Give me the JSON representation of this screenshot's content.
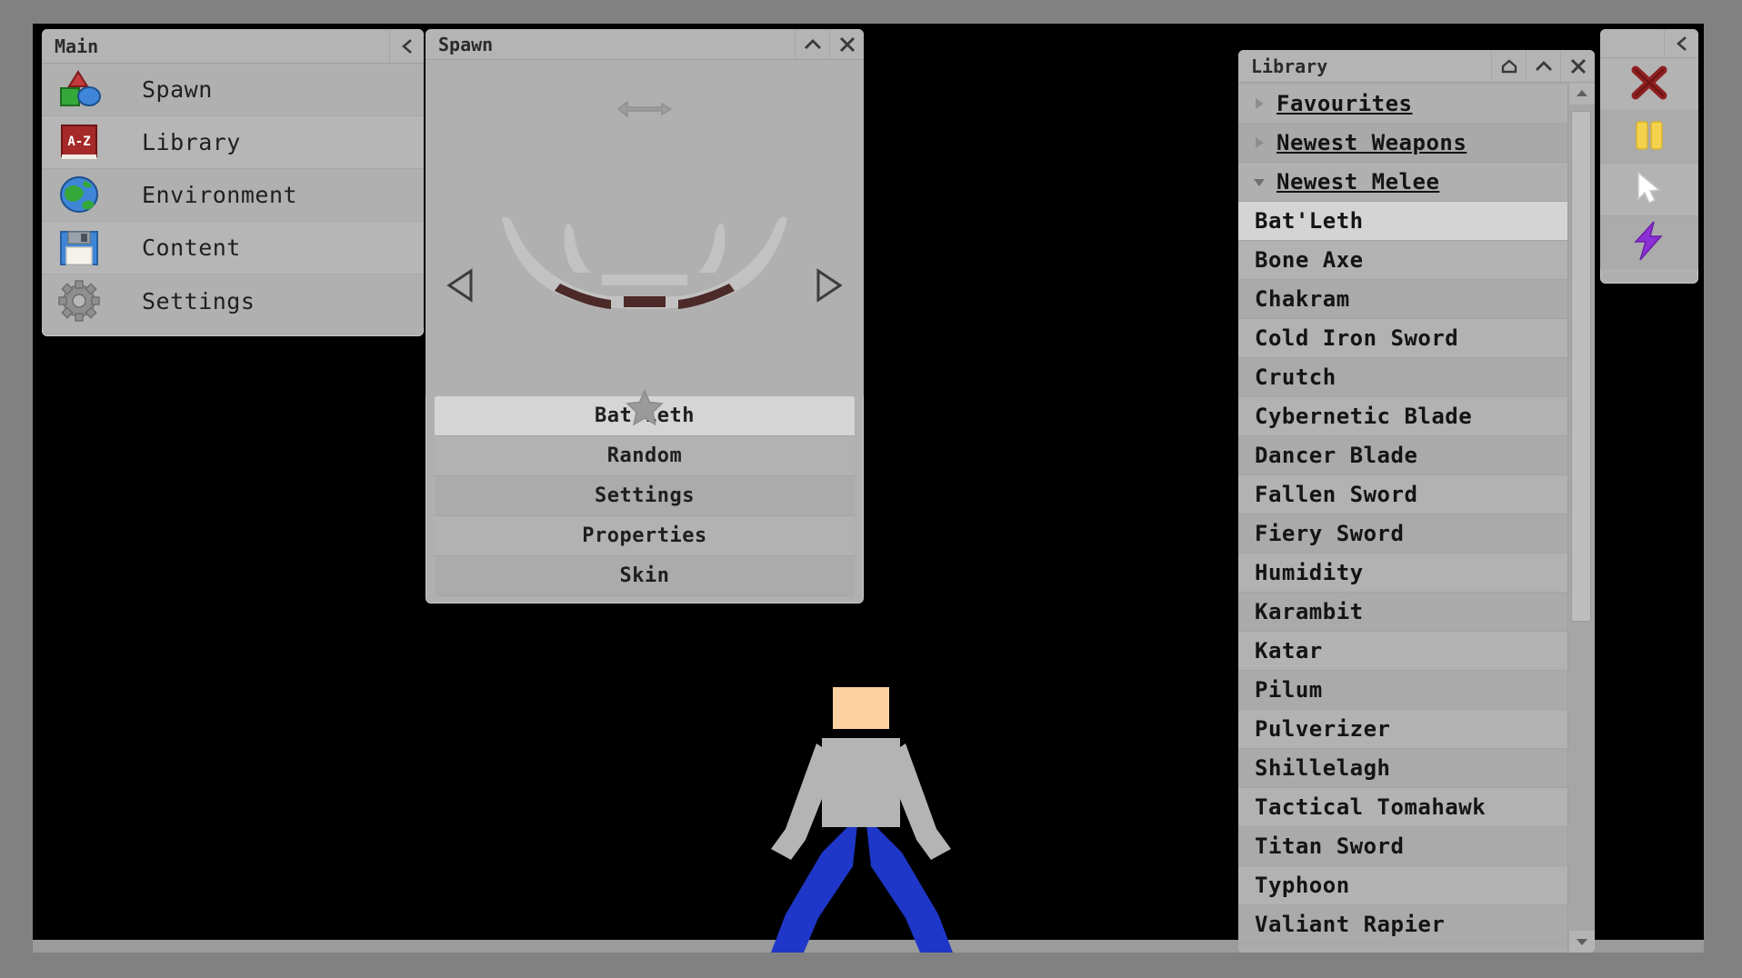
{
  "app": {
    "background_color": "#818181",
    "canvas_color": "#000000",
    "panel_color": "#b0b0b0"
  },
  "main_panel": {
    "title": "Main",
    "collapse_icon": "chevron-left-icon",
    "items": [
      {
        "label": "Spawn",
        "icon": "shapes-icon"
      },
      {
        "label": "Library",
        "icon": "book-az-icon"
      },
      {
        "label": "Environment",
        "icon": "globe-icon"
      },
      {
        "label": "Content",
        "icon": "floppy-disk-icon"
      },
      {
        "label": "Settings",
        "icon": "gear-icon"
      }
    ]
  },
  "spawn_panel": {
    "title": "Spawn",
    "title_buttons": [
      {
        "icon": "chevron-up-icon",
        "name": "collapse-button"
      },
      {
        "icon": "close-icon",
        "name": "close-button"
      }
    ],
    "resize_icon": "double-arrow-icon",
    "prev_icon": "triangle-left-icon",
    "next_icon": "triangle-right-icon",
    "favourite_icon": "star-icon",
    "preview_item": "Bat'Leth",
    "buttons": [
      {
        "label": "Bat'Leth",
        "selected": true
      },
      {
        "label": "Random",
        "selected": false
      },
      {
        "label": "Settings",
        "selected": false
      },
      {
        "label": "Properties",
        "selected": false
      },
      {
        "label": "Skin",
        "selected": false
      }
    ]
  },
  "library_panel": {
    "title": "Library",
    "title_buttons": [
      {
        "icon": "home-icon",
        "name": "home-button"
      },
      {
        "icon": "chevron-up-icon",
        "name": "collapse-button"
      },
      {
        "icon": "close-icon",
        "name": "close-button"
      }
    ],
    "groups": [
      {
        "label": "Favourites",
        "expanded": false,
        "icon": "triangle-right-icon"
      },
      {
        "label": "Newest Weapons",
        "expanded": false,
        "icon": "triangle-right-icon"
      },
      {
        "label": "Newest Melee",
        "expanded": true,
        "icon": "triangle-down-icon"
      }
    ],
    "items": [
      {
        "label": "Bat'Leth",
        "selected": true
      },
      {
        "label": "Bone Axe",
        "selected": false
      },
      {
        "label": "Chakram",
        "selected": false
      },
      {
        "label": "Cold Iron Sword",
        "selected": false
      },
      {
        "label": "Crutch",
        "selected": false
      },
      {
        "label": "Cybernetic Blade",
        "selected": false
      },
      {
        "label": "Dancer Blade",
        "selected": false
      },
      {
        "label": "Fallen Sword",
        "selected": false
      },
      {
        "label": "Fiery Sword",
        "selected": false
      },
      {
        "label": "Humidity",
        "selected": false
      },
      {
        "label": "Karambit",
        "selected": false
      },
      {
        "label": "Katar",
        "selected": false
      },
      {
        "label": "Pilum",
        "selected": false
      },
      {
        "label": "Pulverizer",
        "selected": false
      },
      {
        "label": "Shillelagh",
        "selected": false
      },
      {
        "label": "Tactical Tomahawk",
        "selected": false
      },
      {
        "label": "Titan Sword",
        "selected": false
      },
      {
        "label": "Typhoon",
        "selected": false
      },
      {
        "label": "Valiant Rapier",
        "selected": false
      }
    ],
    "scrollbar": {
      "up_icon": "scroll-up-arrow-icon",
      "down_icon": "scroll-down-arrow-icon"
    }
  },
  "tool_panel": {
    "collapse_icon": "chevron-left-icon",
    "buttons": [
      {
        "icon": "delete-x-icon",
        "name": "delete-tool",
        "color": "#8f2020"
      },
      {
        "icon": "pause-icon",
        "name": "pause-tool",
        "color": "#f5d24b"
      },
      {
        "icon": "cursor-icon",
        "name": "select-tool",
        "color": "#ffffff"
      },
      {
        "icon": "lightning-icon",
        "name": "shock-tool",
        "color": "#8b2fd6"
      }
    ]
  },
  "scene": {
    "character": {
      "head_color": "#ffd1a0",
      "torso_color": "#b4b4b4",
      "arm_color": "#b4b4b4",
      "leg_color": "#1e37c8"
    },
    "ground_color": "#9b9b9b"
  }
}
